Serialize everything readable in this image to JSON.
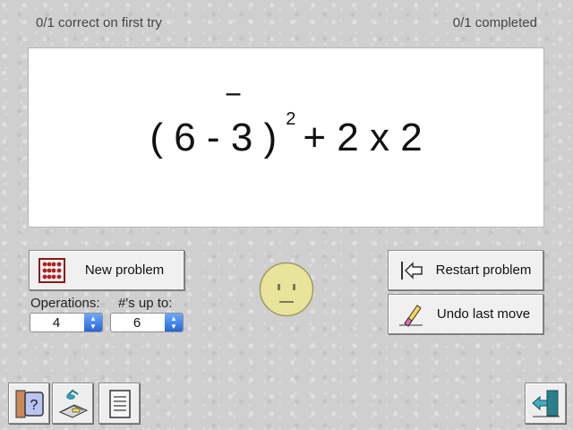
{
  "status": {
    "first_try": "0/1 correct on first try",
    "completed": "0/1 completed"
  },
  "problem": {
    "open_paren": "(",
    "a": "6",
    "minus": "-",
    "negative_sign": "‾",
    "b": "3",
    "close_paren": ")",
    "exponent": "2",
    "plus": "+",
    "c": "2",
    "times": "x",
    "d": "2"
  },
  "buttons": {
    "new_problem": "New problem",
    "restart_problem": "Restart problem",
    "undo_last_move": "Undo last move"
  },
  "selects": {
    "operations_label": "Operations:",
    "operations_value": "4",
    "numbers_label": "#'s up to:",
    "numbers_value": "6"
  },
  "icons": {
    "new_problem": "abacus-icon",
    "restart": "restart-arrow-icon",
    "undo": "eraser-icon",
    "face": "neutral-face-icon",
    "help": "help-icon",
    "lesson": "lesson-icon",
    "notes": "notes-icon",
    "exit": "exit-door-icon"
  },
  "colors": {
    "face_fill": "#e8e49a",
    "select_arrow": "#2766d6"
  }
}
